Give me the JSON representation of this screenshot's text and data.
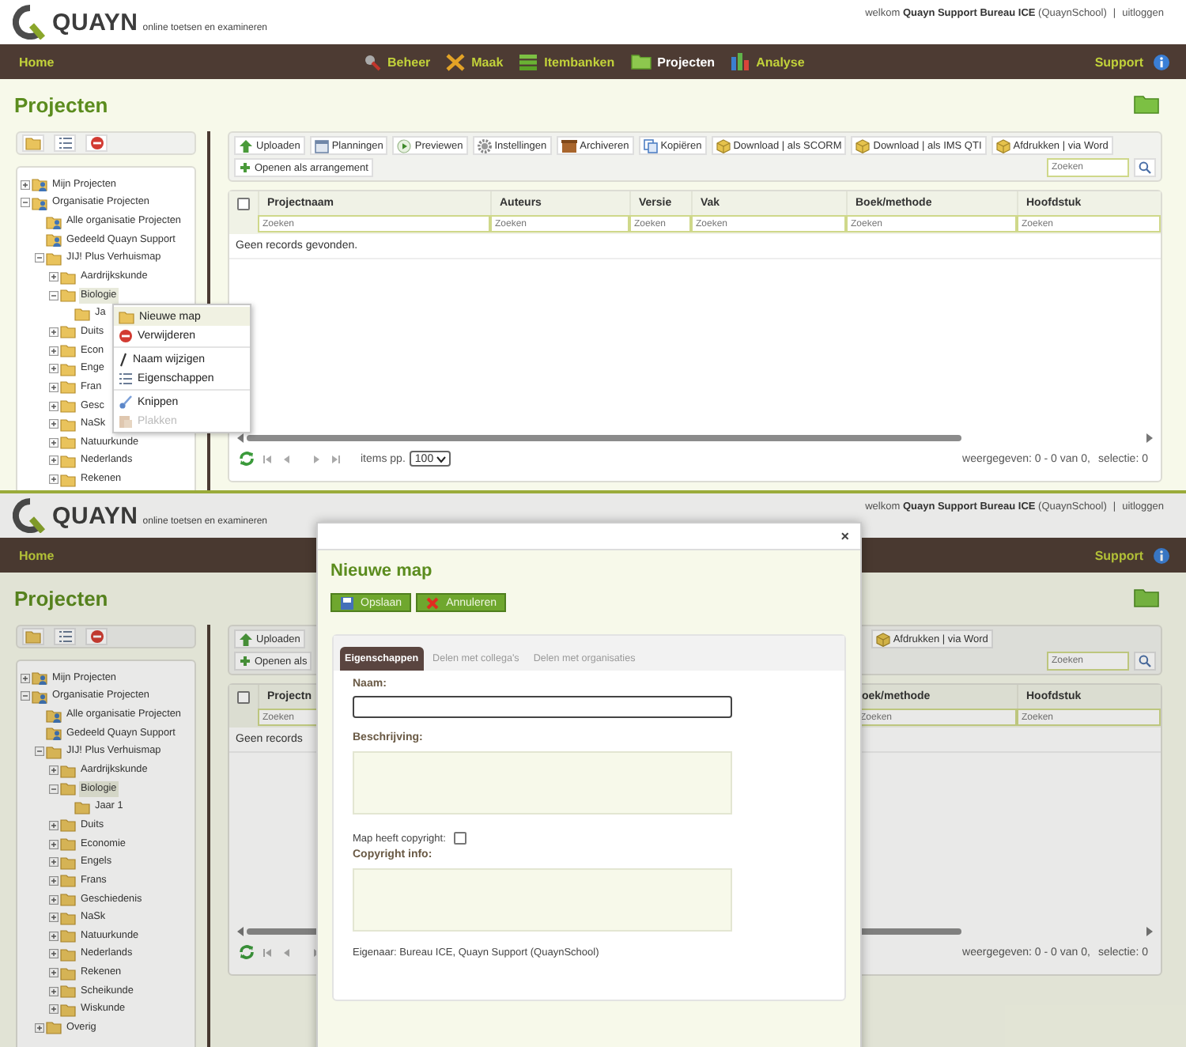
{
  "screens": [
    {
      "dimmed": false,
      "header": {
        "logo": "QUAYN",
        "tagline": "online toetsen en examineren",
        "greeting": "welkom **Quayn Support Bureau ICE** (QuaynSchool)",
        "separator": "|",
        "logout": "uitloggen"
      },
      "nav": {
        "home": "Home",
        "items": [
          {
            "label": "Beheer",
            "selected": false
          },
          {
            "label": "Maak",
            "selected": false
          },
          {
            "label": "Itembanken",
            "selected": false
          },
          {
            "label": "Projecten",
            "selected": true
          },
          {
            "label": "Analyse",
            "selected": false
          }
        ],
        "support": "Support"
      },
      "page_title": "Projecten",
      "tree": [
        {
          "label": "Mijn Projecten",
          "kind": "user-folder",
          "expanded": false,
          "selected": false
        },
        {
          "label": "Organisatie Projecten",
          "kind": "user-folder",
          "expanded": true,
          "selected": false,
          "children": [
            {
              "label": "Alle organisatie Projecten",
              "kind": "user-folder",
              "selected": false
            },
            {
              "label": "Gedeeld Quayn Support",
              "kind": "user-folder",
              "selected": false
            },
            {
              "label": "JIJ! Plus Verhuismap",
              "kind": "folder",
              "expanded": true,
              "selected": false,
              "children": [
                {
                  "label": "Aardrijkskunde",
                  "kind": "folder",
                  "expanded": false,
                  "selected": false
                },
                {
                  "label": "Biologie",
                  "kind": "folder",
                  "expanded": true,
                  "selected": true,
                  "children": [
                    {
                      "label": "Ja",
                      "kind": "folder",
                      "selected": false
                    }
                  ]
                },
                {
                  "label": "Duits",
                  "kind": "folder",
                  "expanded": false,
                  "selected": false
                },
                {
                  "label": "Econ",
                  "kind": "folder",
                  "expanded": false,
                  "selected": false
                },
                {
                  "label": "Enge",
                  "kind": "folder",
                  "expanded": false,
                  "selected": false
                },
                {
                  "label": "Fran",
                  "kind": "folder",
                  "expanded": false,
                  "selected": false
                },
                {
                  "label": "Gesc",
                  "kind": "folder",
                  "expanded": false,
                  "selected": false
                },
                {
                  "label": "NaSk",
                  "kind": "folder",
                  "expanded": false,
                  "selected": false
                },
                {
                  "label": "Natuurkunde",
                  "kind": "folder",
                  "expanded": false,
                  "selected": false
                },
                {
                  "label": "Nederlands",
                  "kind": "folder",
                  "expanded": false,
                  "selected": false
                },
                {
                  "label": "Rekenen",
                  "kind": "folder",
                  "expanded": false,
                  "selected": false
                }
              ]
            }
          ]
        }
      ],
      "context_menu": {
        "groups": [
          [
            {
              "label": "Nieuwe map",
              "kind": "folder",
              "selected": true,
              "disabled": false
            },
            {
              "label": "Verwijderen",
              "kind": "delete",
              "selected": false,
              "disabled": false
            }
          ],
          [
            {
              "label": "Naam wijzigen",
              "kind": "rename",
              "selected": false,
              "disabled": false
            },
            {
              "label": "Eigenschappen",
              "kind": "properties",
              "selected": false,
              "disabled": false
            }
          ],
          [
            {
              "label": "Knippen",
              "kind": "cut",
              "selected": false,
              "disabled": false
            },
            {
              "label": "Plakken",
              "kind": "paste",
              "selected": false,
              "disabled": true
            }
          ]
        ]
      },
      "toolbar": {
        "buttons": [
          {
            "label": "Uploaden",
            "kind": "upload"
          },
          {
            "label": "Planningen",
            "kind": "calendar"
          },
          {
            "label": "Previewen",
            "kind": "play"
          },
          {
            "label": "Instellingen",
            "kind": "gear"
          },
          {
            "label": "Archiveren",
            "kind": "archive"
          },
          {
            "label": "Kopiëren",
            "kind": "copy"
          },
          {
            "label": "Download | als SCORM",
            "kind": "package"
          },
          {
            "label": "Download | als IMS QTI",
            "kind": "package"
          },
          {
            "label": "Afdrukken | via Word",
            "kind": "package"
          }
        ],
        "row_2": [
          {
            "label": "Openen als arrangement",
            "kind": "plus"
          }
        ],
        "search": {
          "placeholder": "Zoeken"
        }
      },
      "grid": {
        "select_all": {
          "checked": false
        },
        "columns": [
          {
            "label": "Projectnaam",
            "placeholder": "Zoeken"
          },
          {
            "label": "Auteurs",
            "placeholder": "Zoeken"
          },
          {
            "label": "Versie",
            "placeholder": "Zoeken"
          },
          {
            "label": "Vak",
            "placeholder": "Zoeken"
          },
          {
            "label": "Boek/methode",
            "placeholder": "Zoeken"
          },
          {
            "label": "Hoofdstuk",
            "placeholder": "Zoeken"
          }
        ],
        "empty_text": "Geen records gevonden.",
        "footer": {
          "items_label": "items pp.",
          "page_size": "100",
          "summary": "weergegeven: 0 - 0 van 0,",
          "selection": "selectie: 0"
        }
      }
    },
    {
      "dimmed": true,
      "header": {
        "logo": "QUAYN",
        "tagline": "online toetsen en examineren",
        "greeting": "welkom **Quayn Support Bureau ICE** (QuaynSchool)",
        "separator": "|",
        "logout": "uitloggen"
      },
      "nav": {
        "home": "Home",
        "support": "Support"
      },
      "page_title": "Projecten",
      "tree": [
        {
          "label": "Mijn Projecten",
          "kind": "user-folder",
          "expanded": false,
          "selected": false
        },
        {
          "label": "Organisatie Projecten",
          "kind": "user-folder",
          "expanded": true,
          "selected": false,
          "children": [
            {
              "label": "Alle organisatie Projecten",
              "kind": "user-folder",
              "selected": false
            },
            {
              "label": "Gedeeld Quayn Support",
              "kind": "user-folder",
              "selected": false
            },
            {
              "label": "JIJ! Plus Verhuismap",
              "kind": "folder",
              "expanded": true,
              "selected": false,
              "children": [
                {
                  "label": "Aardrijkskunde",
                  "kind": "folder",
                  "expanded": false,
                  "selected": false
                },
                {
                  "label": "Biologie",
                  "kind": "folder",
                  "expanded": true,
                  "selected": true,
                  "children": [
                    {
                      "label": "Jaar 1",
                      "kind": "folder",
                      "selected": false
                    }
                  ]
                },
                {
                  "label": "Duits",
                  "kind": "folder",
                  "expanded": false,
                  "selected": false
                },
                {
                  "label": "Economie",
                  "kind": "folder",
                  "expanded": false,
                  "selected": false
                },
                {
                  "label": "Engels",
                  "kind": "folder",
                  "expanded": false,
                  "selected": false
                },
                {
                  "label": "Frans",
                  "kind": "folder",
                  "expanded": false,
                  "selected": false
                },
                {
                  "label": "Geschiedenis",
                  "kind": "folder",
                  "expanded": false,
                  "selected": false
                },
                {
                  "label": "NaSk",
                  "kind": "folder",
                  "expanded": false,
                  "selected": false
                },
                {
                  "label": "Natuurkunde",
                  "kind": "folder",
                  "expanded": false,
                  "selected": false
                },
                {
                  "label": "Nederlands",
                  "kind": "folder",
                  "expanded": false,
                  "selected": false
                },
                {
                  "label": "Rekenen",
                  "kind": "folder",
                  "expanded": false,
                  "selected": false
                },
                {
                  "label": "Scheikunde",
                  "kind": "folder",
                  "expanded": false,
                  "selected": false
                },
                {
                  "label": "Wiskunde",
                  "kind": "folder",
                  "expanded": false,
                  "selected": false
                }
              ]
            },
            {
              "label": "Overig",
              "kind": "folder",
              "expanded": false,
              "selected": false
            }
          ]
        }
      ],
      "toolbar": {
        "buttons": [
          {
            "label": "Uploaden",
            "kind": "upload"
          },
          {
            "label": "Afdrukken | via Word",
            "kind": "package"
          }
        ],
        "row_2": [
          {
            "label": "Openen als",
            "kind": "plus"
          }
        ],
        "search": {
          "placeholder": "Zoeken"
        }
      },
      "grid": {
        "select_all": {
          "checked": false
        },
        "columns": [
          {
            "label": "Projectn",
            "placeholder": "Zoeken"
          },
          {
            "label": "oek/methode",
            "placeholder": "Zoeken"
          },
          {
            "label": "Hoofdstuk",
            "placeholder": "Zoeken"
          }
        ],
        "empty_text": "Geen records",
        "footer": {
          "summary": "weergegeven: 0 - 0 van 0,",
          "selection": "selectie: 0"
        }
      },
      "dialog": {
        "close": "×",
        "title": "Nieuwe map",
        "buttons": [
          {
            "label": "Opslaan",
            "kind": "save"
          },
          {
            "label": "Annuleren",
            "kind": "cancel"
          }
        ],
        "tabs": [
          {
            "label": "Eigenschappen",
            "selected": true
          },
          {
            "label": "Delen met collega's",
            "selected": false
          },
          {
            "label": "Delen met organisaties",
            "selected": false
          }
        ],
        "name": {
          "label": "Naam:",
          "focused": true
        },
        "description": {
          "label": "Beschrijving:"
        },
        "copyright": {
          "label": "Map heeft copyright:",
          "checked": false
        },
        "copyright_info": {
          "label": "Copyright info:"
        },
        "owner": "Eigenaar:  Bureau ICE, Quayn Support (QuaynSchool)"
      }
    }
  ]
}
